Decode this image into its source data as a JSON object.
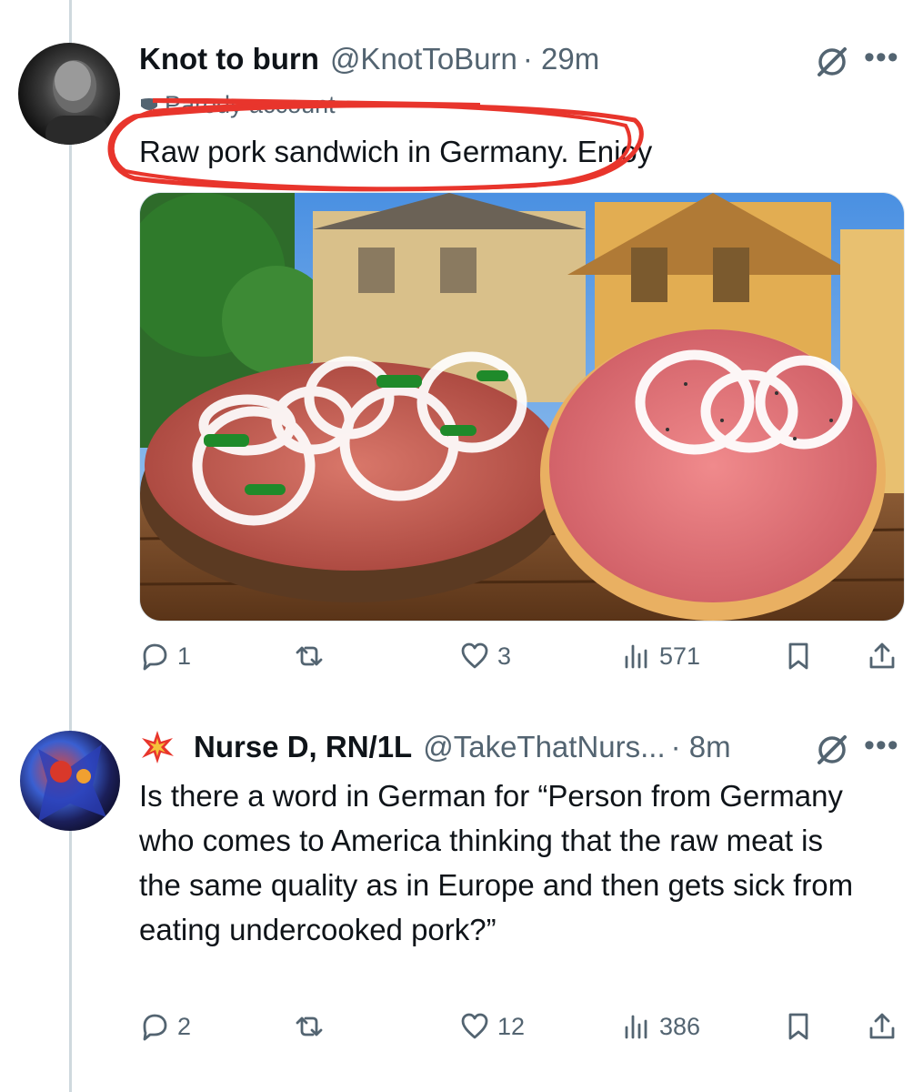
{
  "tweets": [
    {
      "display_name": "Knot to burn",
      "handle": "@KnotToBurn",
      "time": "· 29m",
      "label": "Parody account",
      "text": "Raw pork sandwich in Germany. Enjoy",
      "stats": {
        "replies": "1",
        "reposts": "",
        "likes": "3",
        "views": "571"
      }
    },
    {
      "display_name": "Nurse D, RN/1L",
      "handle": "@TakeThatNurs...",
      "time": "· 8m",
      "badge_icon": "collision-emoji-icon",
      "text": "Is there a word in German for “Person from Germany who comes to America thinking that the raw meat is the same quality as in Europe and then gets sick from eating undercooked pork?”",
      "stats": {
        "replies": "2",
        "reposts": "",
        "likes": "12",
        "views": "386"
      }
    }
  ],
  "colors": {
    "text": "#0f1419",
    "secondary": "#536471",
    "annotation": "#e8352c",
    "thread_line": "#cfd9de"
  }
}
